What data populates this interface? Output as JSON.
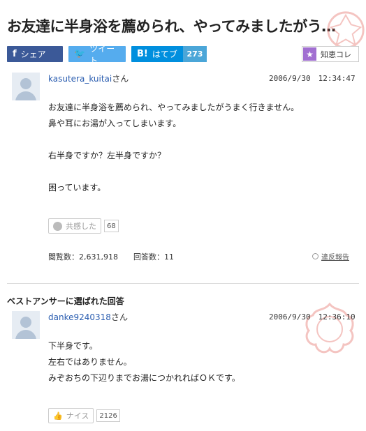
{
  "question": {
    "title": "お友達に半身浴を薦められ、やってみましたがう…",
    "user_name": "kasutera_kuitai",
    "user_suffix": "さん",
    "date": "2006/9/30　12:34:47",
    "body": [
      "お友達に半身浴を薦められ、やってみましたがうまく行きません。",
      "鼻や耳にお湯が入ってしまいます。",
      "",
      "右半身ですか？左半身ですか？",
      "",
      "困っています。"
    ],
    "empathy_label": "共感した",
    "empathy_count": "68",
    "views": "閲覧数：2,631,918",
    "answers": "回答数：11",
    "report_label": "違反報告"
  },
  "share": {
    "facebook_label": "シェア",
    "twitter_label": "ツイート",
    "hatena_label": "はてブ",
    "hatena_count": "273",
    "chiecolle_label": "知恵コレ"
  },
  "best_answer": {
    "section_label": "ベストアンサーに選ばれた回答",
    "user_name": "danke9240318",
    "user_suffix": "さん",
    "date": "2006/9/30　12:36:10",
    "body": [
      "下半身です。",
      "左右ではありません。",
      "みぞおちの下辺りまでお湯につかれればＯＫです。"
    ],
    "nice_label": "ナイス",
    "nice_count": "2126"
  },
  "colors": {
    "facebook": "#3b5998",
    "twitter": "#55acee",
    "hatena": "#008fde",
    "chiecolle": "#a16fd1",
    "link": "#2a5db0",
    "stamp": "#e05a4f"
  }
}
